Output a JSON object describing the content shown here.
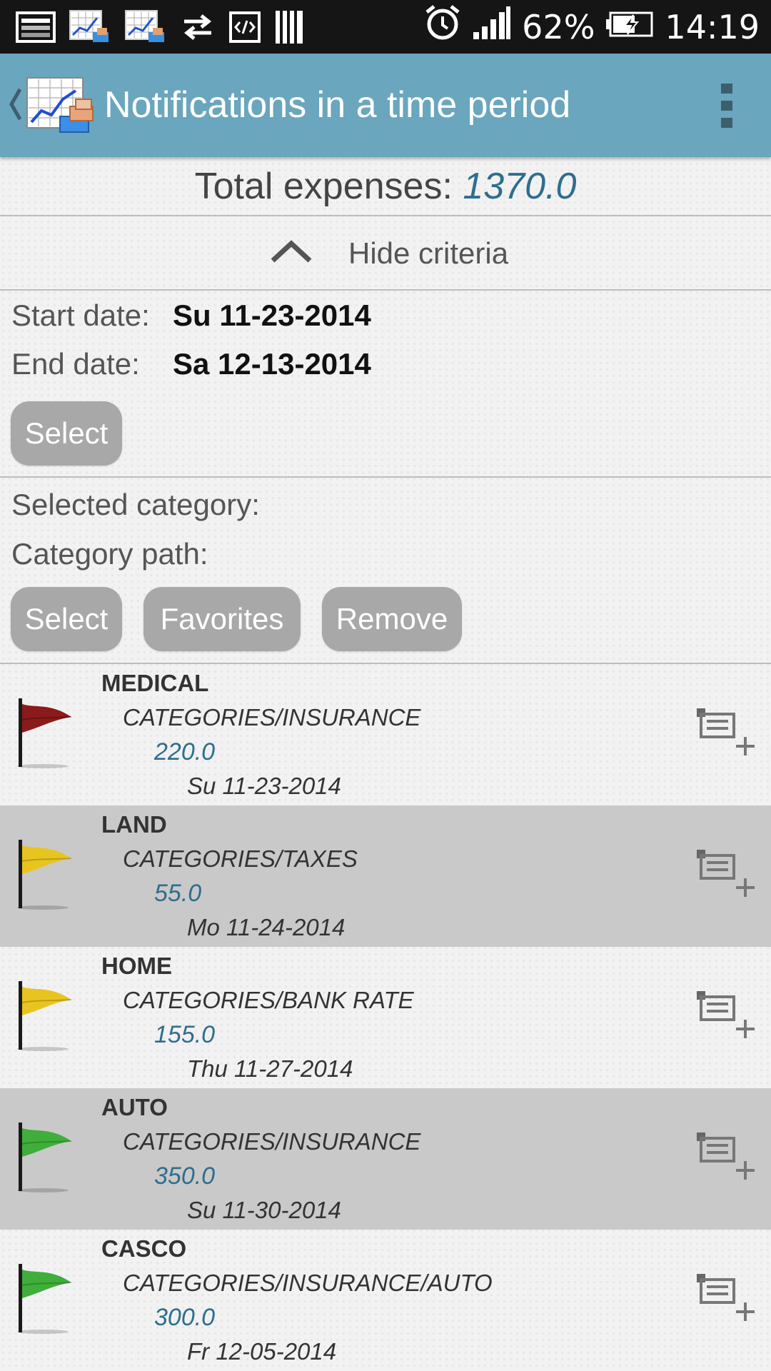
{
  "status_bar": {
    "battery": "62%",
    "time": "14:19"
  },
  "action_bar": {
    "title": "Notifications in a time period"
  },
  "summary": {
    "total_label": "Total expenses:",
    "total_value": "1370.0"
  },
  "criteria": {
    "hide_label": "Hide criteria",
    "start_label": "Start date:",
    "start_value": "Su 11-23-2014",
    "end_label": "End date:",
    "end_value": "Sa 12-13-2014",
    "date_select_label": "Select",
    "selected_category_label": "Selected category:",
    "category_path_label": "Category path:",
    "category_select_label": "Select",
    "favorites_label": "Favorites",
    "remove_label": "Remove"
  },
  "items": [
    {
      "name": "MEDICAL",
      "path": "CATEGORIES/INSURANCE",
      "amount": "220.0",
      "date": "Su 11-23-2014",
      "flag_color": "#8b1a1a"
    },
    {
      "name": "LAND",
      "path": "CATEGORIES/TAXES",
      "amount": "55.0",
      "date": "Mo 11-24-2014",
      "flag_color": "#e8c51e"
    },
    {
      "name": "HOME",
      "path": "CATEGORIES/BANK RATE",
      "amount": "155.0",
      "date": "Thu 11-27-2014",
      "flag_color": "#e8c51e"
    },
    {
      "name": "AUTO",
      "path": "CATEGORIES/INSURANCE",
      "amount": "350.0",
      "date": "Su 11-30-2014",
      "flag_color": "#3fae3a"
    },
    {
      "name": "CASCO",
      "path": "CATEGORIES/INSURANCE/AUTO",
      "amount": "300.0",
      "date": "Fr 12-05-2014",
      "flag_color": "#3fae3a"
    }
  ],
  "colors": {
    "action_bar": "#6aa6bd",
    "amount_text": "#2e6e8e",
    "button": "#a8a8a8",
    "alt_row": "#c9c9c9"
  },
  "icons": {
    "status_left": [
      "picture-icon",
      "chart-app-icon",
      "chart-app-icon",
      "sync-arrows-icon",
      "code-icon",
      "barcode-icon"
    ],
    "status_right": [
      "alarm-icon",
      "signal-icon",
      "battery-charging-icon"
    ],
    "row_action": "add-to-list-icon"
  }
}
